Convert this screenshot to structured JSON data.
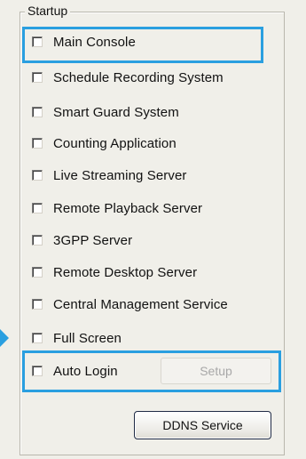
{
  "group": {
    "title": "Startup"
  },
  "items": [
    {
      "label": "Main Console"
    },
    {
      "label": "Schedule Recording System"
    },
    {
      "label": "Smart Guard System"
    },
    {
      "label": "Counting Application"
    },
    {
      "label": "Live Streaming Server"
    },
    {
      "label": "Remote Playback Server"
    },
    {
      "label": "3GPP Server"
    },
    {
      "label": "Remote Desktop Server"
    },
    {
      "label": "Central Management Service"
    },
    {
      "label": "Full Screen"
    },
    {
      "label": "Auto Login"
    }
  ],
  "buttons": {
    "setup_label": "Setup",
    "ddns_label": "DDNS Service"
  },
  "colors": {
    "highlight": "#2a9fe0"
  }
}
